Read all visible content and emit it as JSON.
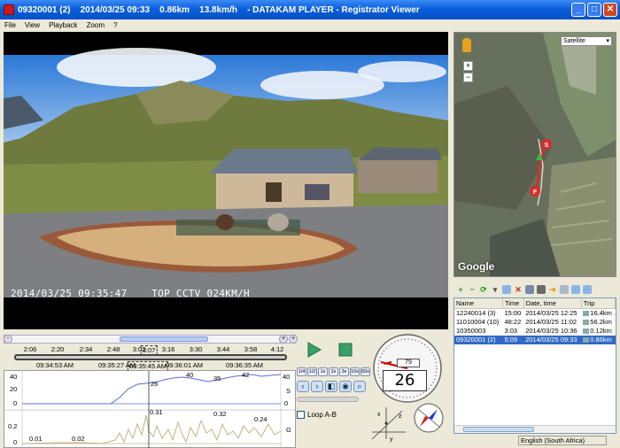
{
  "window": {
    "title": "09320001 (2)    2014/03/25 09:33    0.86km    13.8km/h    - DATAKAM PLAYER - Registrator Viewer",
    "buttons": {
      "minimize": "_",
      "maximize": "□",
      "close": "✕"
    }
  },
  "menu": [
    "File",
    "View",
    "Playback",
    "Zoom",
    "?"
  ],
  "video": {
    "osd": "2014/03/25 09:35:47    TOP CCTV 024KM/H"
  },
  "map": {
    "type_select": "Satellite",
    "zoom_in": "+",
    "zoom_out": "−",
    "logo": "Google",
    "markers": [
      "S",
      "F"
    ]
  },
  "tracks": {
    "columns": [
      "Name",
      "Time",
      "Date, time",
      "Trip"
    ],
    "rows": [
      {
        "name": "12240014 (3)",
        "time": "15:00",
        "date": "2014/03/25 12:25",
        "trip": "16.4km",
        "selected": false
      },
      {
        "name": "11010004 (10)",
        "time": "48:22",
        "date": "2014/03/25 11:02",
        "trip": "56.2km",
        "selected": false
      },
      {
        "name": "10350003",
        "time": "3:03",
        "date": "2014/03/25 10:36",
        "trip": "0.12km",
        "selected": false
      },
      {
        "name": "09320001 (2)",
        "time": "5:09",
        "date": "2014/03/25 09:33",
        "trip": "0.86km",
        "selected": true
      }
    ]
  },
  "status": {
    "locale": "English (South Africa)"
  },
  "timeline": {
    "zoom_out": "-",
    "zoom_in": "+",
    "ticks": [
      "2:06",
      "2:20",
      "2:34",
      "2:48",
      "3:02",
      "3:07",
      "3:16",
      "3:30",
      "3:44",
      "3:58",
      "4:12"
    ],
    "clocks": [
      "09:34:53 AM",
      "09:35:27 AM",
      "09:35:45 AM",
      "09:36:01 AM",
      "09:36:35 AM"
    ],
    "speed_axis": {
      "ticks": [
        "40",
        "20",
        "0"
      ],
      "right": "40",
      "label": "S",
      "right_zero": "0"
    },
    "g_axis": {
      "ticks": [
        "0.2",
        "0"
      ],
      "label": "G"
    },
    "speed_labels": [
      "26",
      "40",
      "35",
      "42"
    ],
    "g_labels": [
      "0.01",
      "0.02",
      "0.31",
      "0.32",
      "0.24"
    ]
  },
  "playback": {
    "speeds": [
      "1/4",
      "1/2",
      "1x",
      "2x",
      "3x",
      "10x",
      "60x"
    ],
    "loop_label": "Loop A-B"
  },
  "gauge": {
    "speed": "26",
    "odometer": "79"
  },
  "colors": {
    "title_bar": "#0a5fdc",
    "selection": "#316ac5",
    "speed_graph": "#5a6fd8",
    "g_graph": "#c2b280",
    "map_marker": "#d92c2c"
  }
}
